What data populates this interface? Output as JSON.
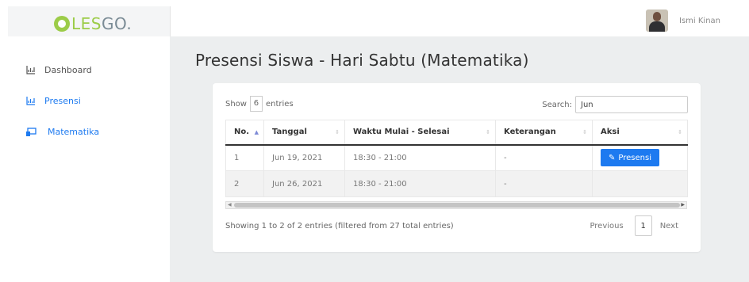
{
  "app": {
    "logo_part1": "LES",
    "logo_part2": "GO."
  },
  "user": {
    "name": "Ismi Kinan"
  },
  "sidebar": {
    "items": [
      {
        "label": "Dashboard",
        "icon": "chart-icon"
      },
      {
        "label": "Presensi",
        "icon": "chart-icon"
      },
      {
        "label": "Matematika",
        "icon": "screen-icon"
      }
    ]
  },
  "page": {
    "title": "Presensi Siswa - Hari Sabtu (Matematika)"
  },
  "table_controls": {
    "show_label": "Show",
    "entries_value": "6",
    "entries_label": "entries",
    "search_label": "Search:",
    "search_value": "Jun"
  },
  "table": {
    "columns": [
      "No.",
      "Tanggal",
      "Waktu Mulai - Selesai",
      "Keterangan",
      "Aksi"
    ],
    "rows": [
      {
        "no": "1",
        "tanggal": "Jun 19, 2021",
        "waktu": "18:30 - 21:00",
        "keterangan": "-",
        "aksi": "Presensi"
      },
      {
        "no": "2",
        "tanggal": "Jun 26, 2021",
        "waktu": "18:30 - 21:00",
        "keterangan": "-",
        "aksi": ""
      }
    ]
  },
  "footer": {
    "info": "Showing 1 to 2 of 2 entries (filtered from 27 total entries)",
    "previous": "Previous",
    "page": "1",
    "next": "Next"
  },
  "colors": {
    "accent": "#1d7af0",
    "logo_green": "#9ccc48",
    "sidebar_active": "#1d7af0"
  }
}
